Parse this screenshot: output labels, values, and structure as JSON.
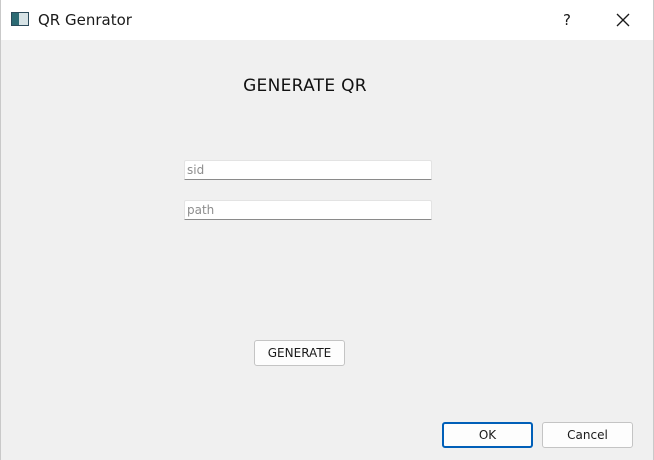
{
  "window": {
    "title": "QR Genrator",
    "help_label": "?"
  },
  "form": {
    "heading": "GENERATE QR",
    "sid_placeholder": "sid",
    "sid_value": "",
    "path_placeholder": "path",
    "path_value": "",
    "generate_label": "GENERATE"
  },
  "dialog_buttons": {
    "ok_label": "OK",
    "cancel_label": "Cancel"
  },
  "icons": {
    "app": "app-icon",
    "close": "close-icon"
  },
  "colors": {
    "background": "#f0f0f0",
    "titlebar": "#ffffff",
    "accent": "#005fb8"
  }
}
